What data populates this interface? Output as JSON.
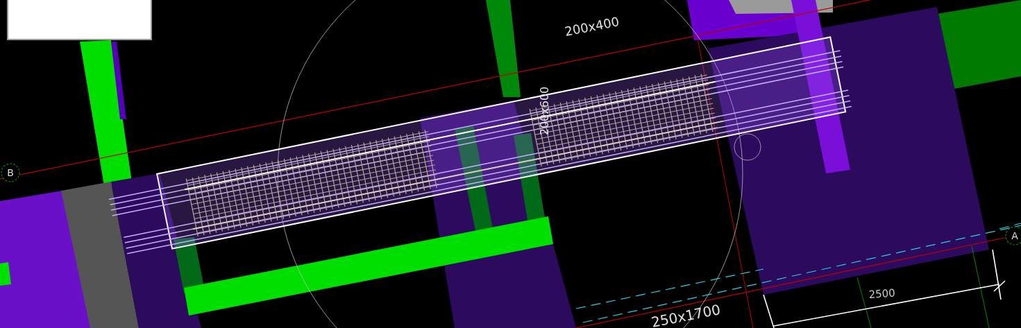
{
  "labels": [
    {
      "kind": "section",
      "text": "200x400"
    },
    {
      "kind": "section",
      "text": "200x600"
    },
    {
      "kind": "section",
      "text": "250x1700"
    },
    {
      "kind": "dimension",
      "text": "2500"
    }
  ],
  "axes": [
    {
      "text": "B"
    },
    {
      "text": "A"
    }
  ]
}
